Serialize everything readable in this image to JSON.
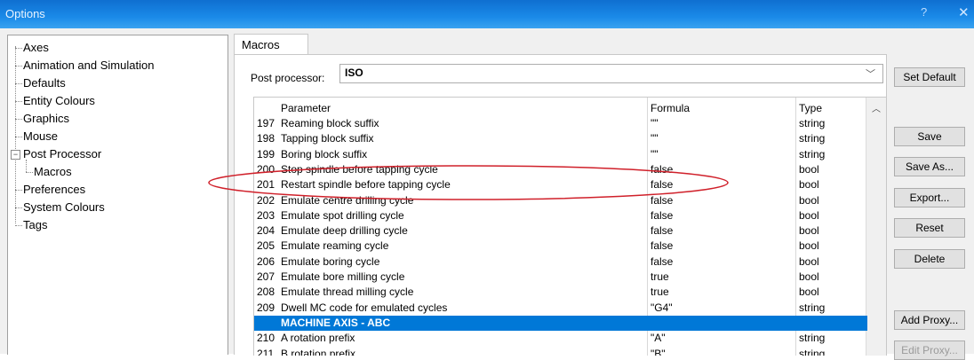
{
  "window": {
    "title": "Options",
    "help_label": "?",
    "close_label": "✕"
  },
  "tree": {
    "items": [
      {
        "label": "Axes"
      },
      {
        "label": "Animation and Simulation"
      },
      {
        "label": "Defaults"
      },
      {
        "label": "Entity Colours"
      },
      {
        "label": "Graphics"
      },
      {
        "label": "Mouse"
      },
      {
        "label": "Post Processor",
        "expanded": true
      },
      {
        "label": "Macros",
        "child": true,
        "selected": true
      },
      {
        "label": "Preferences"
      },
      {
        "label": "System Colours"
      },
      {
        "label": "Tags"
      }
    ],
    "expander_symbol": "−"
  },
  "tab": {
    "label": "Macros"
  },
  "post_processor": {
    "label": "Post processor:",
    "value": "ISO"
  },
  "table": {
    "columns": [
      "Parameter",
      "Formula",
      "Type"
    ],
    "rows": [
      {
        "num": "197",
        "name": "Reaming block suffix",
        "formula": "\"\"",
        "type": "string"
      },
      {
        "num": "198",
        "name": "Tapping block suffix",
        "formula": "\"\"",
        "type": "string"
      },
      {
        "num": "199",
        "name": "Boring block suffix",
        "formula": "\"\"",
        "type": "string"
      },
      {
        "num": "200",
        "name": "Stop spindle before tapping cycle",
        "formula": "false",
        "type": "bool"
      },
      {
        "num": "201",
        "name": "Restart spindle before tapping cycle",
        "formula": "false",
        "type": "bool"
      },
      {
        "num": "202",
        "name": "Emulate centre drilling cycle",
        "formula": "false",
        "type": "bool"
      },
      {
        "num": "203",
        "name": "Emulate spot drilling cycle",
        "formula": "false",
        "type": "bool"
      },
      {
        "num": "204",
        "name": "Emulate deep drilling cycle",
        "formula": "false",
        "type": "bool"
      },
      {
        "num": "205",
        "name": "Emulate reaming cycle",
        "formula": "false",
        "type": "bool"
      },
      {
        "num": "206",
        "name": "Emulate boring cycle",
        "formula": "false",
        "type": "bool"
      },
      {
        "num": "207",
        "name": "Emulate bore milling cycle",
        "formula": "true",
        "type": "bool"
      },
      {
        "num": "208",
        "name": "Emulate thread milling cycle",
        "formula": "true",
        "type": "bool"
      },
      {
        "num": "209",
        "name": "Dwell MC code for emulated cycles",
        "formula": "\"G4\"",
        "type": "string"
      },
      {
        "num": "",
        "name": "MACHINE AXIS - ABC",
        "formula": "",
        "type": "",
        "section": true
      },
      {
        "num": "210",
        "name": "A rotation prefix",
        "formula": "\"A\"",
        "type": "string"
      },
      {
        "num": "211",
        "name": "B rotation prefix",
        "formula": "\"B\"",
        "type": "string"
      }
    ]
  },
  "buttons": {
    "set_default": "Set Default",
    "save": "Save",
    "save_as": "Save As...",
    "export": "Export...",
    "reset": "Reset",
    "delete": "Delete",
    "add_proxy": "Add Proxy...",
    "edit_proxy": "Edit Proxy..."
  },
  "colors": {
    "selection": "#0078d7",
    "annotation": "#d0202a",
    "titlebar": "#1a8ae8"
  },
  "icons": {
    "scroll_up": "chevron-up-icon",
    "dropdown": "chevron-down-icon",
    "close": "close-icon",
    "help": "help-icon"
  }
}
